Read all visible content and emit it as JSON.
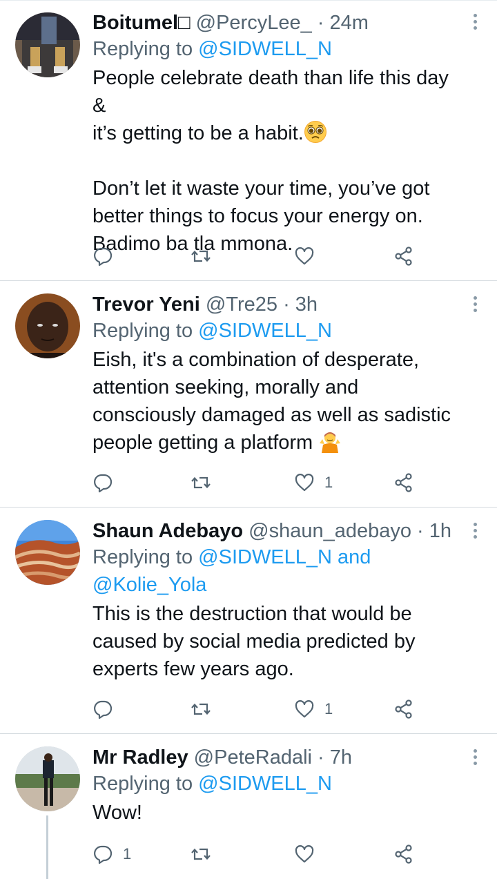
{
  "tweets": [
    {
      "name": "Boitumel□",
      "handle": "@PercyLee_ · 24m",
      "replying_prefix": "Replying to ",
      "replying_to": "@SIDWELL_N",
      "text_before_emoji": "People celebrate death than life this day &\nit’s getting to be a habit.",
      "emoji": "pleading-face-icon",
      "text_after_emoji": "\n\nDon’t let it waste your time, you’ve got\nbetter things to focus your energy on.\nBadimo ba tla mmona.",
      "reply_count": "",
      "retweet_count": "",
      "like_count": ""
    },
    {
      "name": "Trevor Yeni",
      "handle": "@Tre25 · 3h",
      "replying_prefix": "Replying to ",
      "replying_to": "@SIDWELL_N",
      "text_before_emoji": "Eish, it's a combination of desperate,\nattention seeking, morally and\nconsciously damaged as well as sadistic\npeople getting a platform ",
      "emoji": "person-shrugging-icon",
      "text_after_emoji": "",
      "reply_count": "",
      "retweet_count": "",
      "like_count": "1"
    },
    {
      "name": "Shaun Adebayo",
      "handle": "@shaun_adebayo · 1h",
      "replying_prefix": "Replying to ",
      "replying_to": "@SIDWELL_N and\n@Kolie_Yola",
      "text_before_emoji": "This is the destruction that would be\ncaused by social media predicted by\nexperts few years ago.",
      "emoji": "",
      "text_after_emoji": "",
      "reply_count": "",
      "retweet_count": "",
      "like_count": "1"
    },
    {
      "name": "Mr Radley",
      "handle": "@PeteRadali · 7h",
      "replying_prefix": "Replying to ",
      "replying_to": "@SIDWELL_N",
      "text_before_emoji": "Wow!",
      "emoji": "",
      "text_after_emoji": "",
      "reply_count": "1",
      "retweet_count": "",
      "like_count": ""
    }
  ],
  "colors": {
    "text": "#0f1419",
    "secondary": "#536471",
    "link": "#1d9bf0",
    "divider": "#d4dadf",
    "icon": "#536471"
  }
}
